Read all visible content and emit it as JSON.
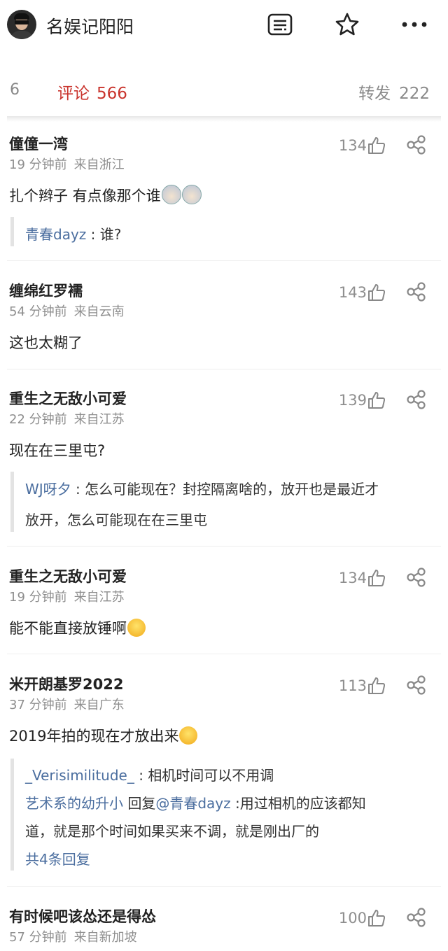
{
  "header": {
    "title": "名娱记阳阳",
    "icons": [
      "article-icon",
      "star-icon",
      "more-icon"
    ]
  },
  "tabs": {
    "like_count": "6",
    "comment_label": "评论",
    "comment_count": "566",
    "repost_label": "转发",
    "repost_count": "222"
  },
  "comments": [
    {
      "name": "僮僮一湾",
      "time": "19 分钟前",
      "location": "来自浙江",
      "likes": "134",
      "text": "扎个辫子 有点像那个谁",
      "reply": {
        "user": "青春dayz",
        "text": " : 谁?"
      }
    },
    {
      "name": "缠绵红罗襦",
      "time": "54 分钟前",
      "location": "来自云南",
      "likes": "143",
      "text": "这也太糊了"
    },
    {
      "name": "重生之无敌小可爱",
      "time": "22 分钟前",
      "location": "来自江苏",
      "likes": "139",
      "text": "现在在三里屯?",
      "reply": {
        "user": "WJ呀夕",
        "text": " : 怎么可能现在？封控隔离啥的，放开也是最近才",
        "text2": "放开，怎么可能现在在三里屯"
      }
    },
    {
      "name": "重生之无敌小可爱",
      "time": "19 分钟前",
      "location": "来自江苏",
      "likes": "134",
      "text": "能不能直接放锤啊"
    },
    {
      "name": "米开朗基罗2022",
      "time": "37 分钟前",
      "location": "来自广东",
      "likes": "113",
      "text": "2019年拍的现在才放出来",
      "replies": {
        "r1_user": "_Verisimilitude_",
        "r1_text": " : 相机时间可以不用调",
        "r2_user": "艺术系的幼升小",
        "r2_mid": " 回复",
        "r2_target": "@青春dayz",
        "r2_text": " :用过相机的应该都知",
        "r2_text2": "道，就是那个时间如果买来不调，就是刚出厂的",
        "more": "共4条回复"
      }
    },
    {
      "name": "有时候吧该怂还是得怂",
      "time": "57 分钟前",
      "location": "来自新加坡",
      "likes": "100"
    }
  ],
  "colors": {
    "accent_red": "#c9332c",
    "link_blue": "#4b6e9f",
    "meta_gray": "#8e8e8e"
  }
}
